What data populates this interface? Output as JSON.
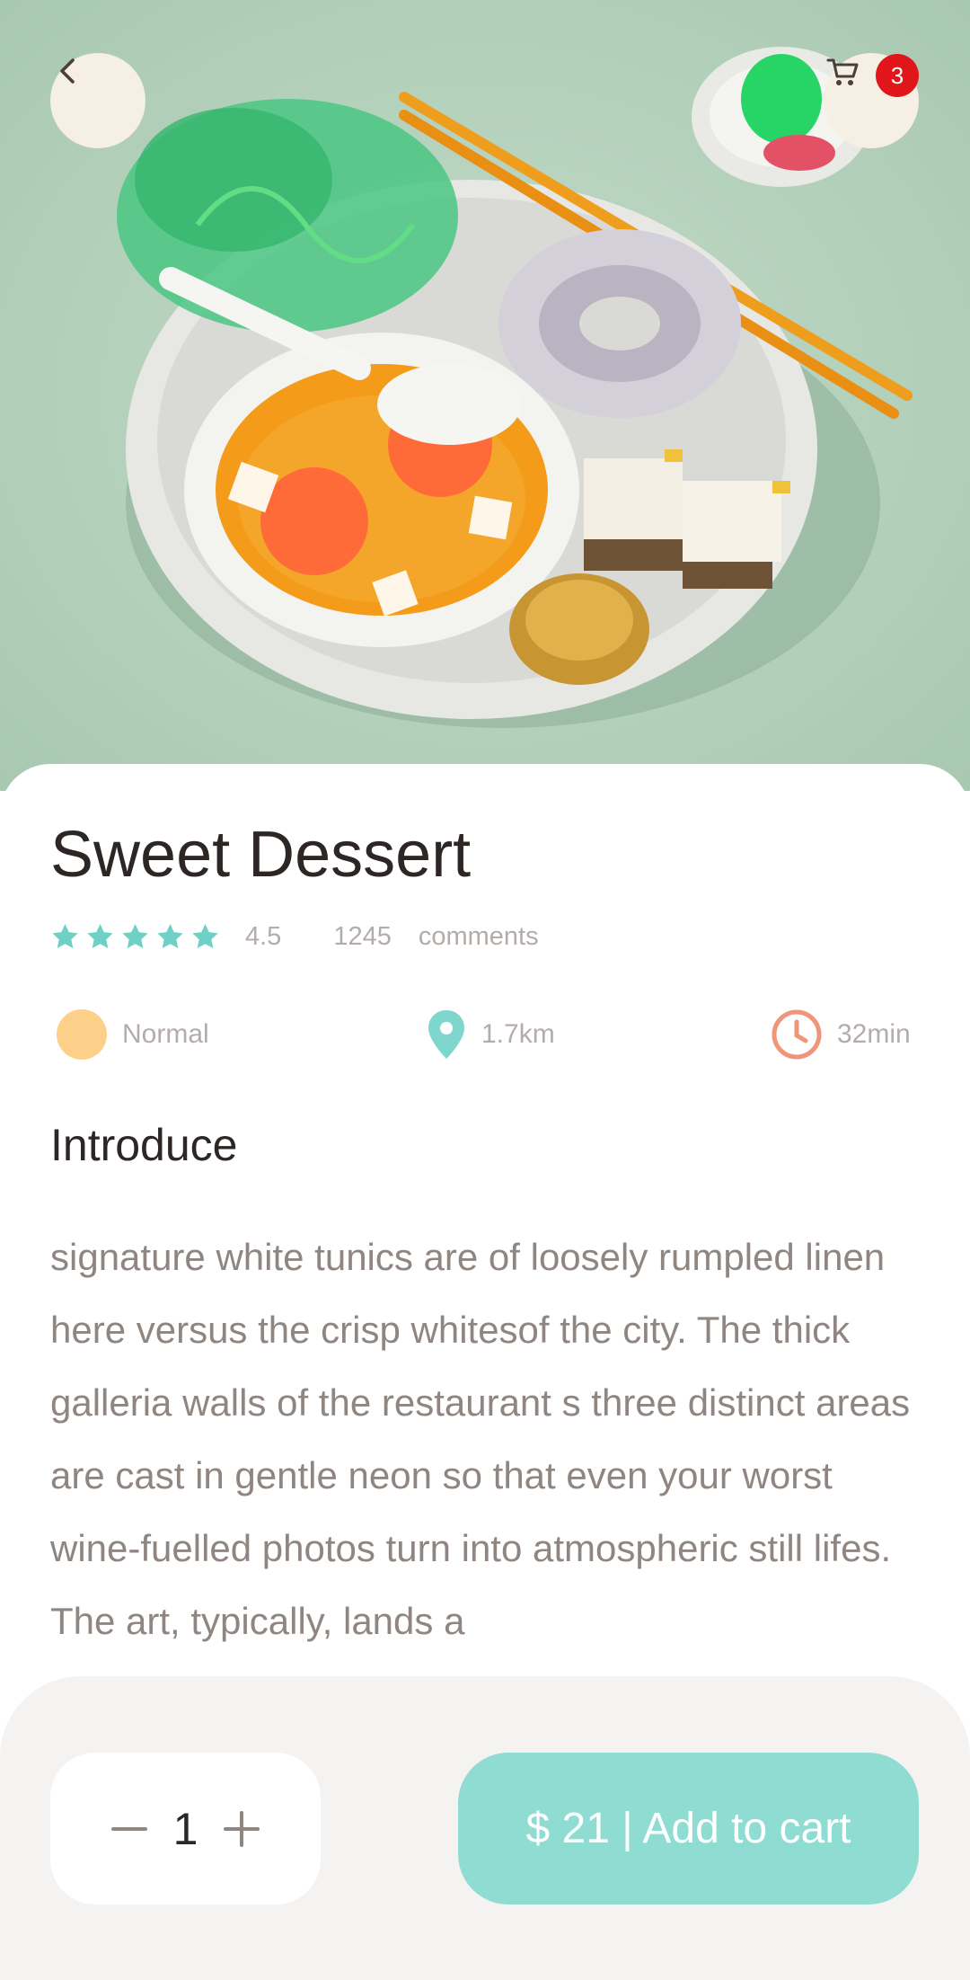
{
  "header": {
    "back_icon": "chevron-left-icon",
    "cart_icon": "cart-icon",
    "cart_badge": "3"
  },
  "product": {
    "title": "Sweet Dessert",
    "rating": "4.5",
    "rating_stars": 5,
    "comments_count": "1245",
    "comments_label": "comments",
    "info": {
      "level": "Normal",
      "distance": "1.7km",
      "time": "32min"
    }
  },
  "introduce": {
    "title": "Introduce",
    "text": "signature white tunics are of loosely rumpled linen here versus the crisp whitesof the city. The thick galleria walls of the restaurant s three distinct areas are cast in gentle neon so that even your worst wine-fuelled photos turn into atmospheric still lifes. The art, typically, lands a"
  },
  "cart": {
    "quantity": "1",
    "add_label": "$ 21 | Add to cart"
  },
  "colors": {
    "accent": "#8fdcd2",
    "star": "#6fd1c6",
    "badge": "#e0161b",
    "level_dot": "#fdd08a",
    "clock": "#f0957a",
    "pin": "#7fd6cc"
  }
}
